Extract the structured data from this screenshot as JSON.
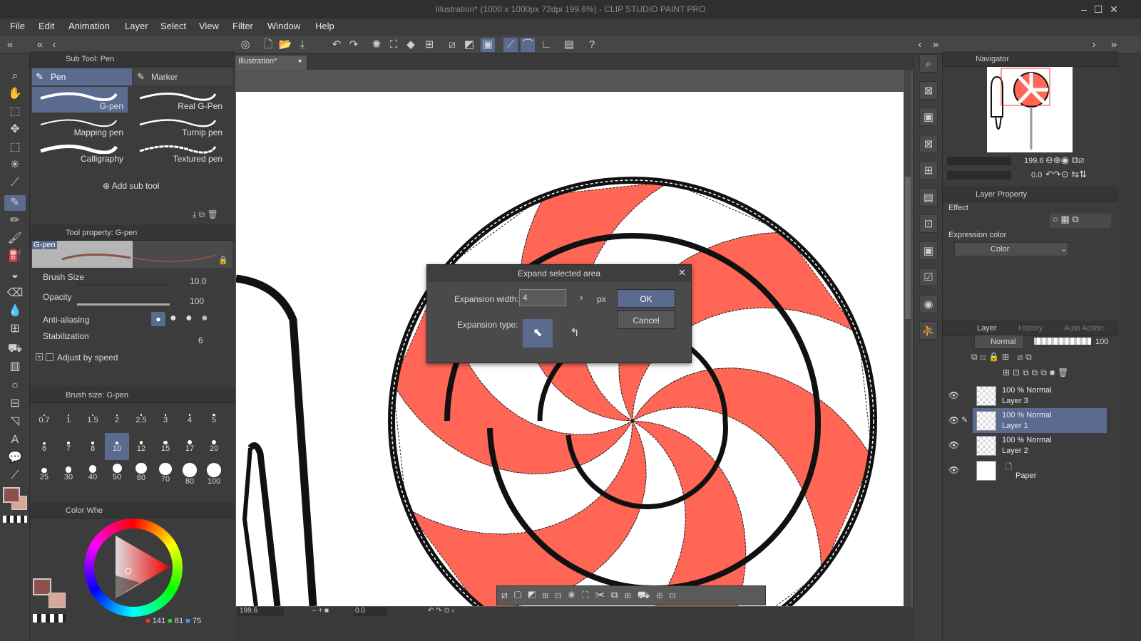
{
  "window": {
    "title": "Illustration* (1000 x 1000px 72dpi 199.6%) - CLIP STUDIO PAINT PRO"
  },
  "menu": [
    "File",
    "Edit",
    "Animation",
    "Layer",
    "Select",
    "View",
    "Filter",
    "Window",
    "Help"
  ],
  "subtool": {
    "header": "Sub Tool: Pen",
    "tabs": [
      "Pen",
      "Marker"
    ],
    "brushes": [
      "G-pen",
      "Real G-Pen",
      "Mapping pen",
      "Turnip pen",
      "Calligraphy",
      "Textured pen"
    ],
    "add_label": "Add sub tool"
  },
  "toolprop": {
    "header": "Tool property: G-pen",
    "preview_label": "G-pen",
    "brush_size_label": "Brush Size",
    "brush_size_value": "10.0",
    "opacity_label": "Opacity",
    "opacity_value": "100",
    "antialias_label": "Anti-aliasing",
    "stabilization_label": "Stabilization",
    "stabilization_value": "6",
    "adjust_label": "Adjust by speed"
  },
  "brushsize": {
    "header": "Brush size: G-pen",
    "sizes": [
      "0.7",
      "1",
      "1.5",
      "2",
      "2.5",
      "3",
      "4",
      "5",
      "6",
      "7",
      "8",
      "10",
      "12",
      "15",
      "17",
      "20",
      "25",
      "30",
      "40",
      "50",
      "60",
      "70",
      "80",
      "100"
    ]
  },
  "color": {
    "header": "Color Whe",
    "rgb": {
      "r": "141",
      "g": "81",
      "b": "75"
    },
    "main_color": "#8d514b",
    "sub_color": "#d8a79b"
  },
  "canvas": {
    "tab_label": "Illustration*",
    "zoom": "199.6",
    "angle": "0.0",
    "candy_color": "#ff6655"
  },
  "dialog": {
    "title": "Expand selected area",
    "width_label": "Expansion width:",
    "width_value": "4",
    "unit": "px",
    "type_label": "Expansion type:",
    "ok": "OK",
    "cancel": "Cancel"
  },
  "navigator": {
    "header": "Navigator",
    "zoom": "199.6",
    "angle": "0.0"
  },
  "layerprop": {
    "header": "Layer Property",
    "effect_label": "Effect",
    "expr_label": "Expression color",
    "expr_value": "Color"
  },
  "layers": {
    "tabs": [
      "Layer",
      "History",
      "Auto Action"
    ],
    "blend": "Normal",
    "opacity": "100",
    "items": [
      {
        "mode": "100 % Normal",
        "name": "Layer 3"
      },
      {
        "mode": "100 % Normal",
        "name": "Layer 1"
      },
      {
        "mode": "100 % Normal",
        "name": "Layer 2"
      },
      {
        "mode": "",
        "name": "Paper"
      }
    ]
  }
}
